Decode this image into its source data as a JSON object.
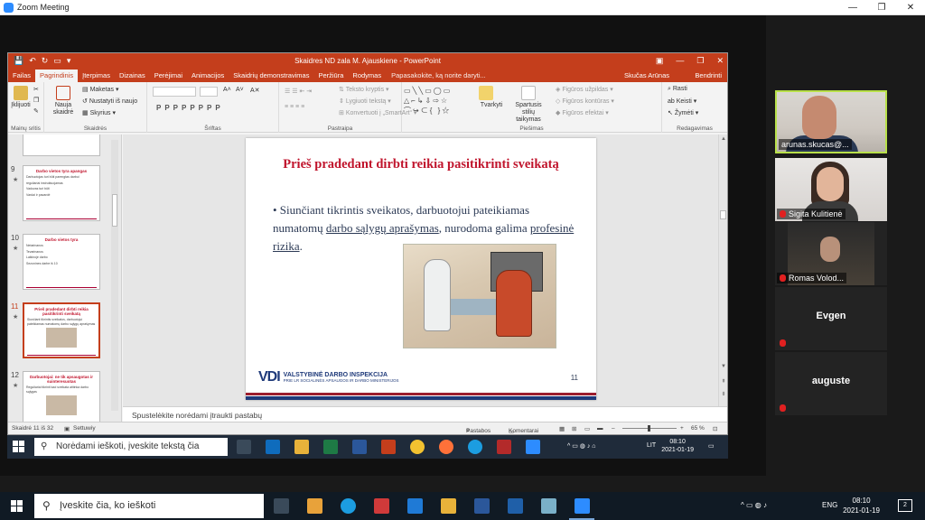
{
  "zoom": {
    "title": "Zoom Meeting",
    "window_controls": [
      "—",
      "❐",
      "✕"
    ]
  },
  "powerpoint": {
    "quick_access": [
      "💾",
      "↶",
      "↻",
      "▭",
      "▾"
    ],
    "document_title": "Skaidres ND zala M. Ajauskiene - PowerPoint",
    "window_controls": [
      "▣",
      "—",
      "❐",
      "✕"
    ],
    "tabs": [
      "Failas",
      "Pagrindinis",
      "Įterpimas",
      "Dizainas",
      "Perėjimai",
      "Animacijos",
      "Skaidrių demonstravimas",
      "Peržiūra",
      "Rodymas"
    ],
    "active_tab": "Pagrindinis",
    "tell_me": "Papasakokite, ką norite daryti...",
    "user": "Skučas Arūnas",
    "share_button": "Bendrinti",
    "ribbon": {
      "clipboard": {
        "paste": "Įklijuoti",
        "label": "Mainų sritis"
      },
      "slides": {
        "new_slide_line1": "Nauja",
        "new_slide_line2": "skaidrė",
        "layout": "Maketas",
        "reset": "Nustatyti iš naujo",
        "section": "Skyrius",
        "label": "Skaidrės"
      },
      "font": {
        "format_buttons": "PPPPPPPP",
        "label": "Šriftas"
      },
      "paragraph": {
        "text_direction": "Teksto kryptis",
        "align_text": "Lygiuoti tekstą",
        "convert_smartart": "Konvertuoti į „SmartArt“",
        "label": "Pastraipa"
      },
      "drawing": {
        "arrange": "Tvarkyti",
        "quick_styles_line1": "Spartusis stilių",
        "quick_styles_line2": "taikymas",
        "shape_fill": "Figūros užpildas",
        "shape_outline": "Figūros kontūras",
        "shape_effects": "Figūros efektai",
        "label": "Piešimas"
      },
      "editing": {
        "find": "Rasti",
        "replace": "Keisti",
        "select": "Žymėti",
        "label": "Redagavimas"
      }
    },
    "thumbnails": [
      {
        "num": "9",
        "title": "Darbo vietos tyra apangas",
        "lines": [
          "Darbuotojas turi būti parengtas darbui",
          "reguliariai instruktuojamas",
          "Vadovas turi būti",
          "Vardai ir pavardė"
        ]
      },
      {
        "num": "10",
        "title": "Darbo vietos tyra",
        "lines": [
          "Netarinanos",
          "Tevarinanos",
          "Laikinoje darbo",
          "Sezonines darbe iš 10"
        ]
      },
      {
        "num": "11",
        "title": "Prieš pradedant dirbti reikia pasitikrinti sveikatą",
        "lines": [
          "Siunčiant tikrintis sveikatos, darbuotojui pateikiamas numatomų darbo sąlygų aprašymas"
        ],
        "selected": true
      },
      {
        "num": "12",
        "title": "Darbuotojai: ne tik apsaugotas ir suinteresuotas",
        "lines": [
          "Reguliariai tikrinti kad sveikata atitinka darbo sąlygas"
        ]
      }
    ],
    "slide": {
      "title": "Prieš pradedant dirbti reikia pasitikrinti sveikatą",
      "bullet_prefix": "• Siunčiant tikrintis sveikatos, darbuotojui pateikiamas numatomų ",
      "link1": "darbo sąlygų aprašymas",
      "bullet_mid": ", nurodoma galima ",
      "link2": "profesinė rizika",
      "bullet_end": ".",
      "logo_mark": "VDI",
      "logo_line1": "VALSTYBINĖ DARBO INSPEKCIJA",
      "logo_line2": "PRIE LR SOCIALINĖS APSAUGOS IR DARBO MINISTERIJOS",
      "page_number": "11"
    },
    "notes_placeholder": "Spustelėkite norėdami įtraukti pastabų",
    "status": {
      "slide_info": "Skaidrė 11 iš 32",
      "language": "Settuwiy",
      "notes": "Pastabos",
      "comments": "Komentarai",
      "zoom_minus": "–",
      "zoom_plus": "+",
      "zoom": "65 %"
    }
  },
  "inner_taskbar": {
    "search_placeholder": "Norėdami ieškoti, įveskite tekstą čia",
    "tray_lang": "LIT",
    "tray_icons": "^ ▭ ◍ ♪ ⌂",
    "time": "08:10",
    "date": "2021-01-19"
  },
  "participants": [
    {
      "name": "arunas.skucas@...",
      "muted": false,
      "video": true,
      "active": true
    },
    {
      "name": "Sigita Kulitienė",
      "muted": true,
      "video": true
    },
    {
      "name": "Romas Volod...",
      "muted": true,
      "video": true
    },
    {
      "name": "Evgen",
      "muted": true,
      "video": false
    },
    {
      "name": "auguste",
      "muted": true,
      "video": false
    }
  ],
  "outer_taskbar": {
    "search_placeholder": "Įveskite čia, ko ieškoti",
    "tray_icons": "^ ▭ ◍ ♪",
    "tray_lang": "ENG",
    "time": "08:10",
    "date": "2021-01-19",
    "notification_count": "2"
  },
  "colors": {
    "ppt_accent": "#c43e1c",
    "slide_title": "#c0142c",
    "zoom_blue": "#2d8cff",
    "active_speaker": "#b8e04a",
    "muted_red": "#e02020"
  }
}
